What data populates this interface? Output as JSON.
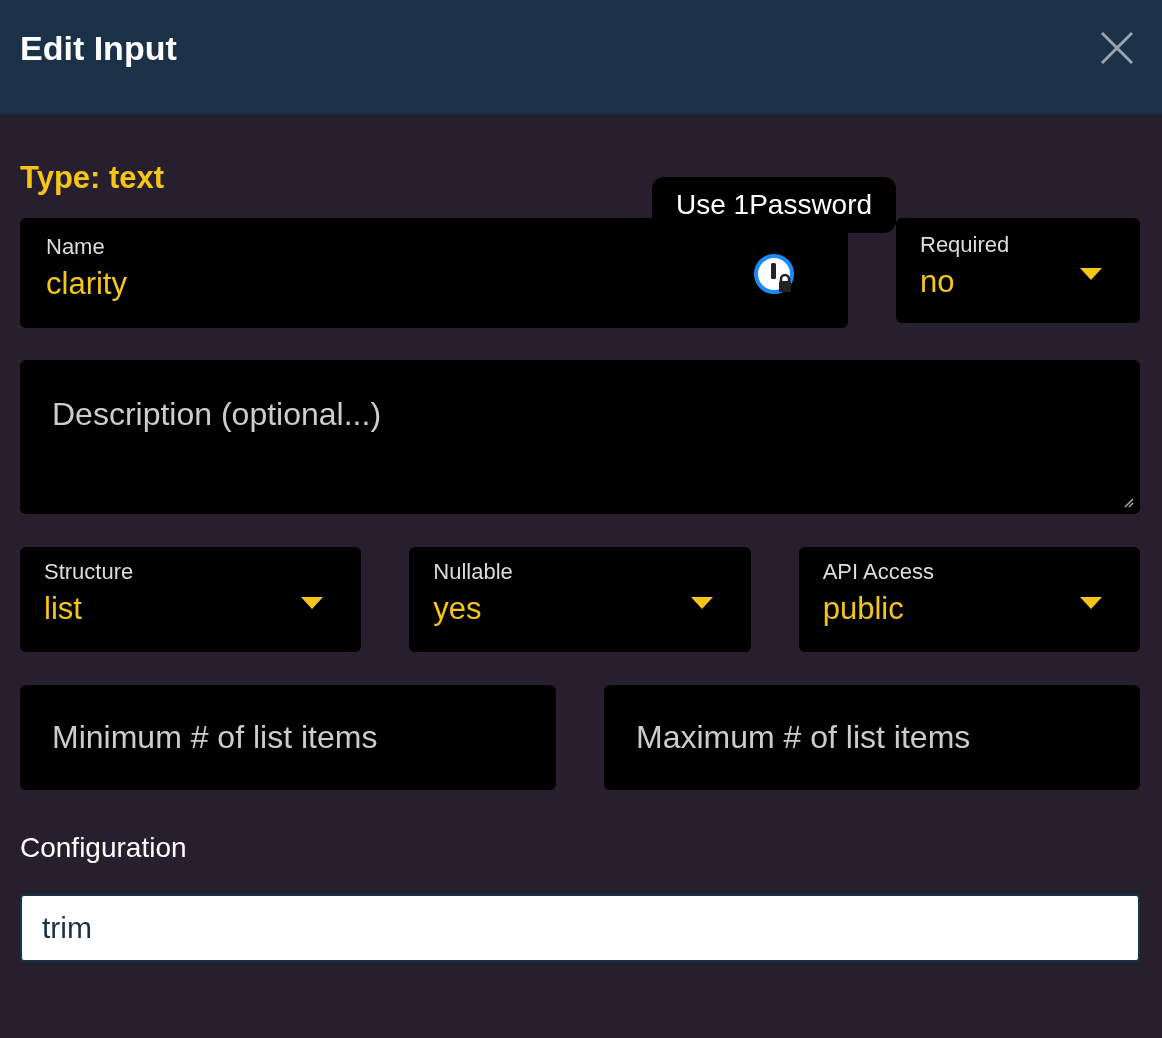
{
  "header": {
    "title": "Edit Input"
  },
  "type_label": "Type: text",
  "tooltip": "Use 1Password",
  "name_field": {
    "label": "Name",
    "value": "clarity"
  },
  "required": {
    "label": "Required",
    "value": "no"
  },
  "description": {
    "placeholder": "Description (optional...)"
  },
  "selects": [
    {
      "label": "Structure",
      "value": "list"
    },
    {
      "label": "Nullable",
      "value": "yes"
    },
    {
      "label": "API Access",
      "value": "public"
    }
  ],
  "limits": [
    {
      "placeholder": "Minimum # of list items"
    },
    {
      "placeholder": "Maximum # of list items"
    }
  ],
  "configuration": {
    "label": "Configuration",
    "value": "trim"
  }
}
